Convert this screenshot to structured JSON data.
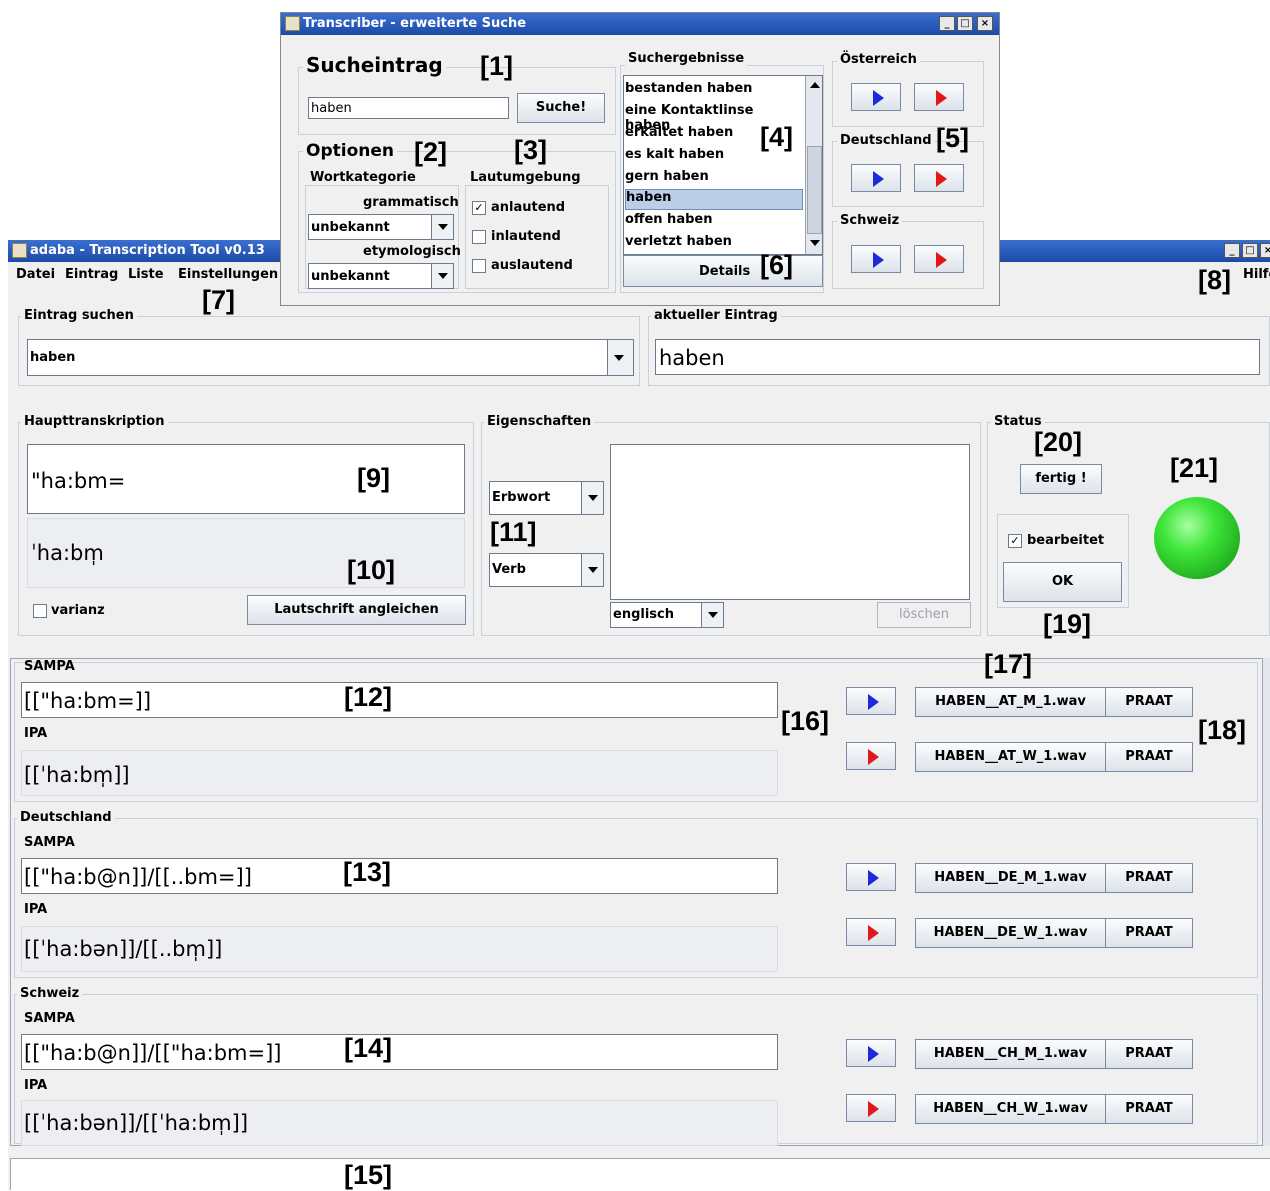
{
  "dialog": {
    "title": "Transcriber - erweiterte Suche",
    "search_group_label": "Sucheintrag",
    "search_value": "haben",
    "search_button": "Suche!",
    "options_label": "Optionen",
    "wortkategorie_label": "Wortkategorie",
    "grammatisch_label": "grammatisch",
    "grammatisch_value": "unbekannt",
    "etymologisch_label": "etymologisch",
    "etymologisch_value": "unbekannt",
    "lautumgebung_label": "Lautumgebung",
    "anlautend_label": "anlautend",
    "anlautend_checked": true,
    "inlautend_label": "inlautend",
    "auslautend_label": "auslautend",
    "results_label": "Suchergebnisse",
    "results": [
      "bestanden haben",
      "eine Kontaktlinse haben",
      "erkältet haben",
      "es kalt haben",
      "gern haben",
      "haben",
      "offen haben",
      "verletzt haben"
    ],
    "selected_result": "haben",
    "details_button": "Details",
    "region_austria": "Österreich",
    "region_germany": "Deutschland",
    "region_switzerland": "Schweiz"
  },
  "app": {
    "title": "adaba - Transcription Tool v0.13",
    "menu": [
      "Datei",
      "Eintrag",
      "Liste",
      "Einstellungen"
    ],
    "menu_help": "Hilfe"
  },
  "entry_search": {
    "label": "Eintrag suchen",
    "value": "haben"
  },
  "current_entry": {
    "label": "aktueller Eintrag",
    "value": "haben"
  },
  "main_transcription": {
    "label": "Haupttranskription",
    "sampa": "\"ha:bm=",
    "ipa": "ˈha:bm̩",
    "varianz_label": "varianz",
    "align_button": "Lautschrift angleichen"
  },
  "properties": {
    "label": "Eigenschaften",
    "word_type": "Erbwort",
    "pos": "Verb",
    "language": "englisch",
    "delete_button": "löschen"
  },
  "status": {
    "label": "Status",
    "done_button": "fertig !",
    "edited_label": "bearbeitet",
    "edited_checked": true,
    "ok_button": "OK",
    "light_color": "#22cc22"
  },
  "regions": {
    "sampa_label": "SAMPA",
    "ipa_label": "IPA",
    "praat_label": "PRAAT",
    "austria": {
      "sampa": "[[\"ha:bm=]]",
      "ipa": "[[ˈha:bm̩]]",
      "file_m": "HABEN__AT_M_1.wav",
      "file_w": "HABEN__AT_W_1.wav"
    },
    "germany": {
      "label": "Deutschland",
      "sampa": "[[\"ha:b@n]]/[[..bm=]]",
      "ipa": "[[ˈha:bən]]/[[..bm̩]]",
      "file_m": "HABEN__DE_M_1.wav",
      "file_w": "HABEN__DE_W_1.wav"
    },
    "switzerland": {
      "label": "Schweiz",
      "sampa": "[[\"ha:b@n]]/[[\"ha:bm=]]",
      "ipa": "[[ˈha:bən]]/[[ˈha:bm̩]]",
      "file_m": "HABEN__CH_M_1.wav",
      "file_w": "HABEN__CH_W_1.wav"
    }
  },
  "callouts": [
    "[1]",
    "[2]",
    "[3]",
    "[4]",
    "[5]",
    "[6]",
    "[7]",
    "[8]",
    "[9]",
    "[10]",
    "[11]",
    "[12]",
    "[13]",
    "[14]",
    "[15]",
    "[16]",
    "[17]",
    "[18]",
    "[19]",
    "[20]",
    "[21]"
  ]
}
